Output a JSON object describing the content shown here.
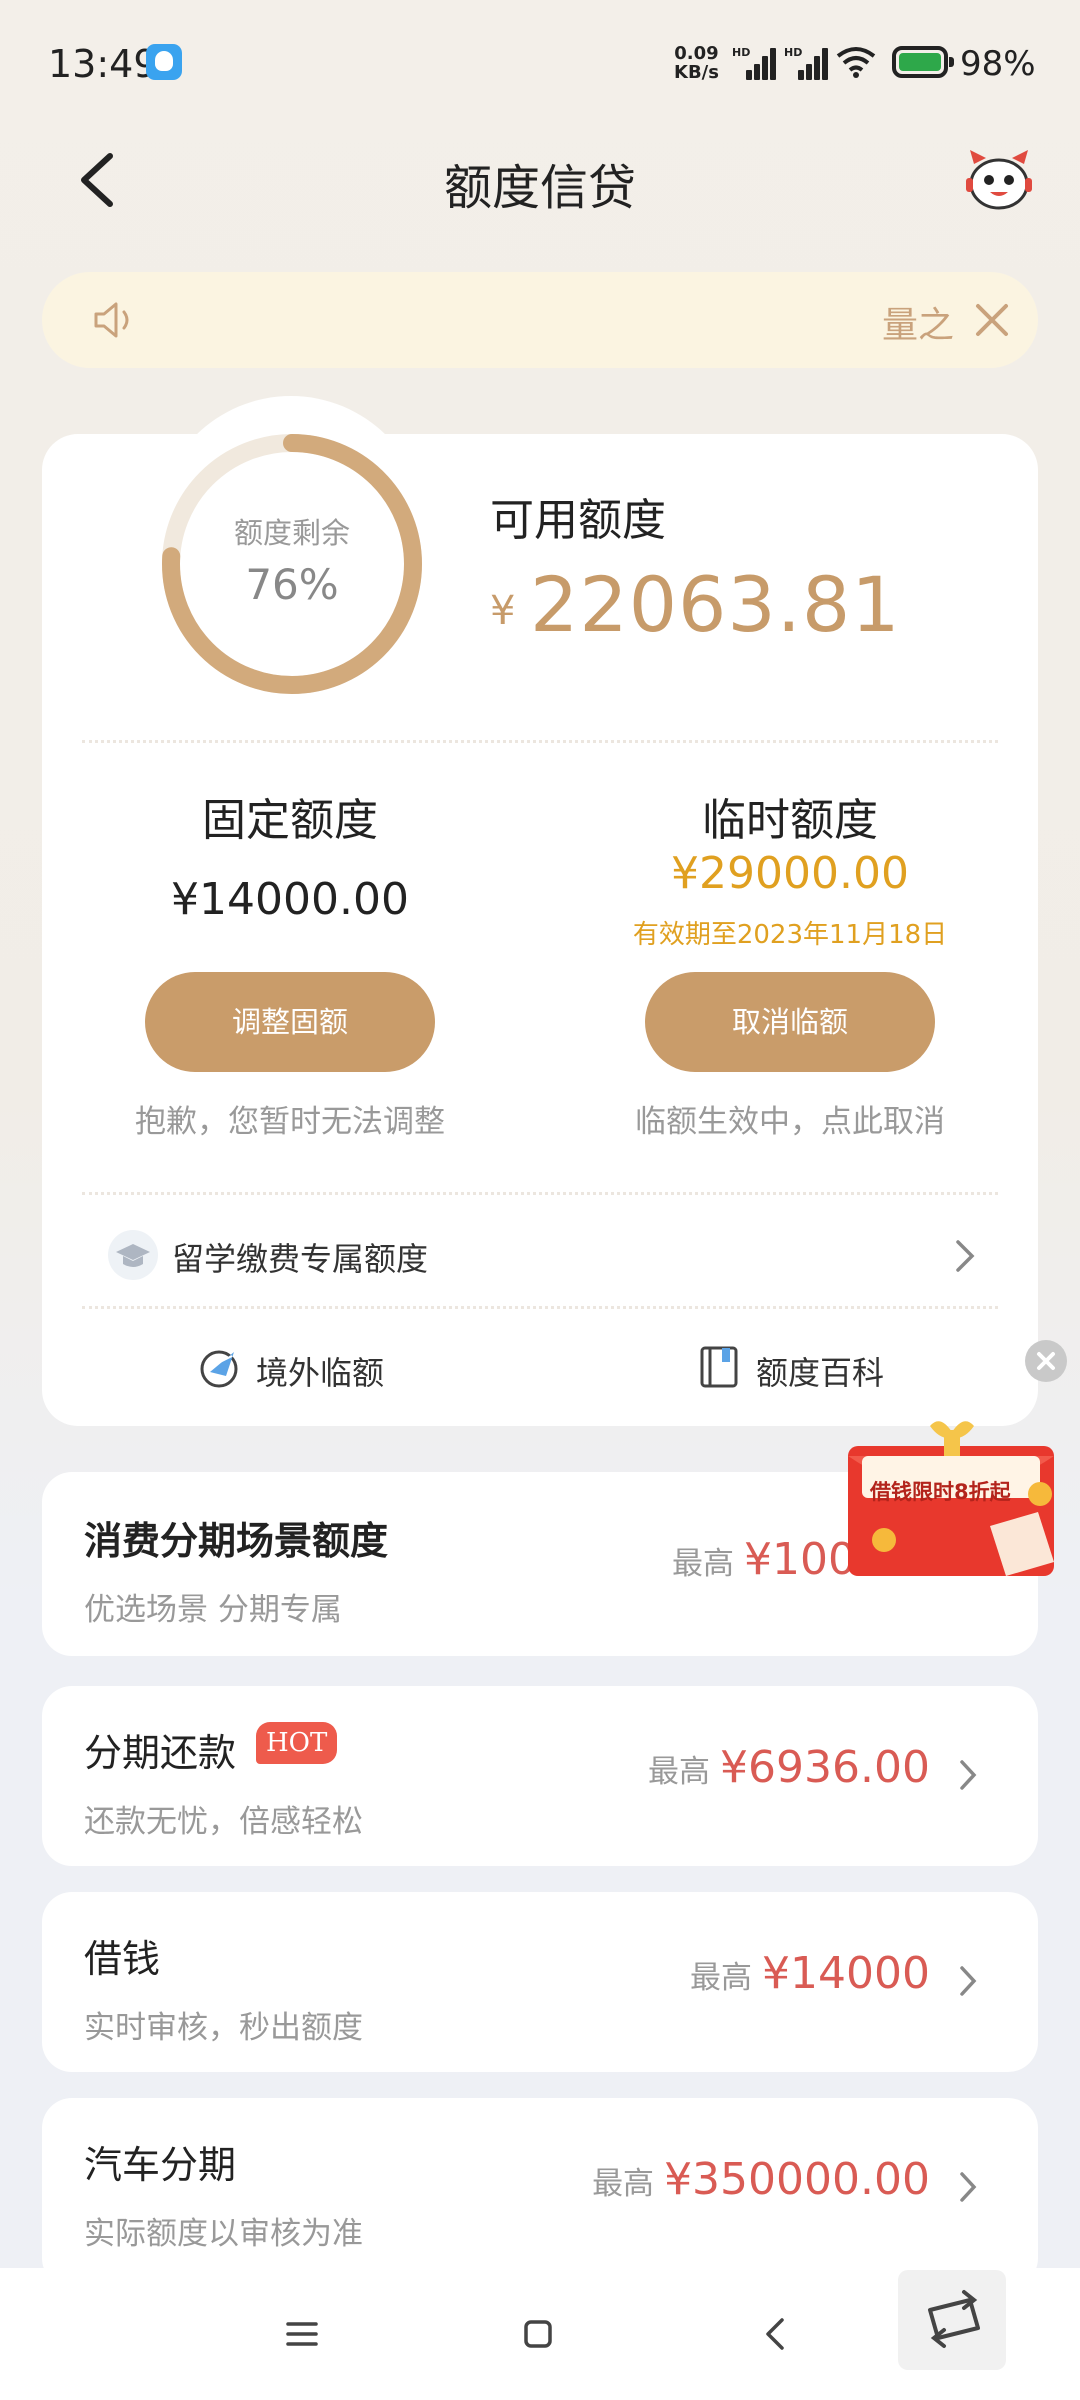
{
  "status_bar": {
    "time": "13:49",
    "net_speed": "0.09",
    "net_unit": "KB/s",
    "sig1_tag": "HD",
    "sig2_tag": "HD",
    "battery": "98%"
  },
  "nav": {
    "title": "额度信贷",
    "back_icon": "chevron-left-icon",
    "service_icon": "mascot-icon"
  },
  "notice": {
    "text": "量之",
    "icon": "speaker-icon"
  },
  "quota": {
    "ring_label": "额度剩余",
    "ring_value": "76%",
    "ring_fraction": 0.76,
    "available_label": "可用额度",
    "available_symbol": "¥",
    "available_amount": "22063.81",
    "fixed": {
      "title": "固定额度",
      "amount": "¥14000.00",
      "button": "调整固额",
      "note": "抱歉，您暂时无法调整"
    },
    "temporary": {
      "title": "临时额度",
      "amount": "¥29000.00",
      "validity": "有效期至2023年11月18日",
      "button": "取消临额",
      "note": "临额生效中，点此取消"
    },
    "study_abroad": "留学缴费专属额度",
    "links": {
      "overseas": "境外临额",
      "wiki": "额度百科"
    }
  },
  "promo": {
    "text": "借钱限时8折起"
  },
  "list": [
    {
      "title": "消费分期场景额度",
      "subtitle": "优选场景 分期专属",
      "max_label": "最高",
      "value": "¥100"
    },
    {
      "title": "分期还款",
      "badge": "HOT",
      "subtitle": "还款无忧，倍感轻松",
      "max_label": "最高",
      "value": "¥6936.00"
    },
    {
      "title": "借钱",
      "subtitle": "实时审核，秒出额度",
      "max_label": "最高",
      "value": "¥14000"
    },
    {
      "title": "汽车分期",
      "subtitle": "实际额度以审核为准",
      "max_label": "最高",
      "value": "¥350000.00"
    }
  ],
  "colors": {
    "accent_gold": "#c99c6a",
    "temp_amber": "#e0a020",
    "value_red": "#d95b54"
  }
}
